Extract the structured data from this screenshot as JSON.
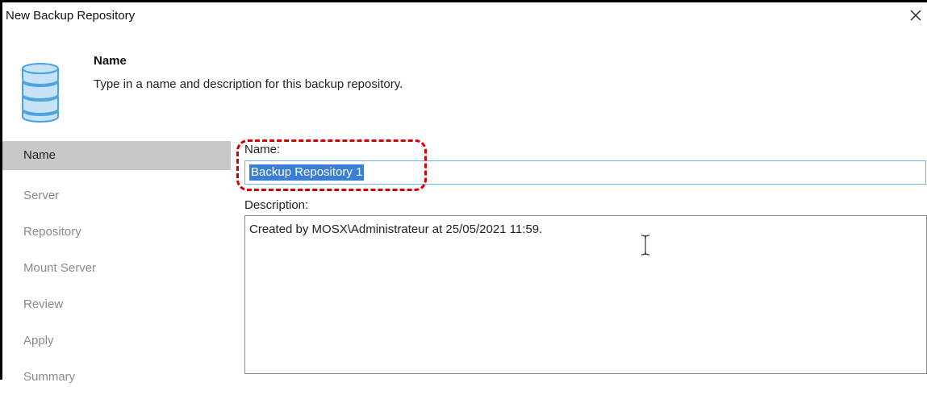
{
  "window": {
    "title": "New Backup Repository"
  },
  "header": {
    "title": "Name",
    "description": "Type in a name and description for this backup repository."
  },
  "nav": {
    "items": [
      {
        "label": "Name",
        "active": true
      },
      {
        "label": "Server",
        "active": false
      },
      {
        "label": "Repository",
        "active": false
      },
      {
        "label": "Mount Server",
        "active": false
      },
      {
        "label": "Review",
        "active": false
      },
      {
        "label": "Apply",
        "active": false
      },
      {
        "label": "Summary",
        "active": false
      }
    ]
  },
  "form": {
    "name_label": "Name:",
    "name_value": "Backup Repository 1",
    "description_label": "Description:",
    "description_value": "Created by MOSX\\Administrateur at 25/05/2021 11:59."
  },
  "colors": {
    "selection": "#3a7fd4",
    "active_nav": "#c8c8c8",
    "annotation": "#d40000",
    "input_focus_border": "#6cb4e6"
  },
  "icons": {
    "header_icon": "database-icon",
    "close_icon": "close-icon",
    "cursor_icon": "text-cursor-icon"
  }
}
